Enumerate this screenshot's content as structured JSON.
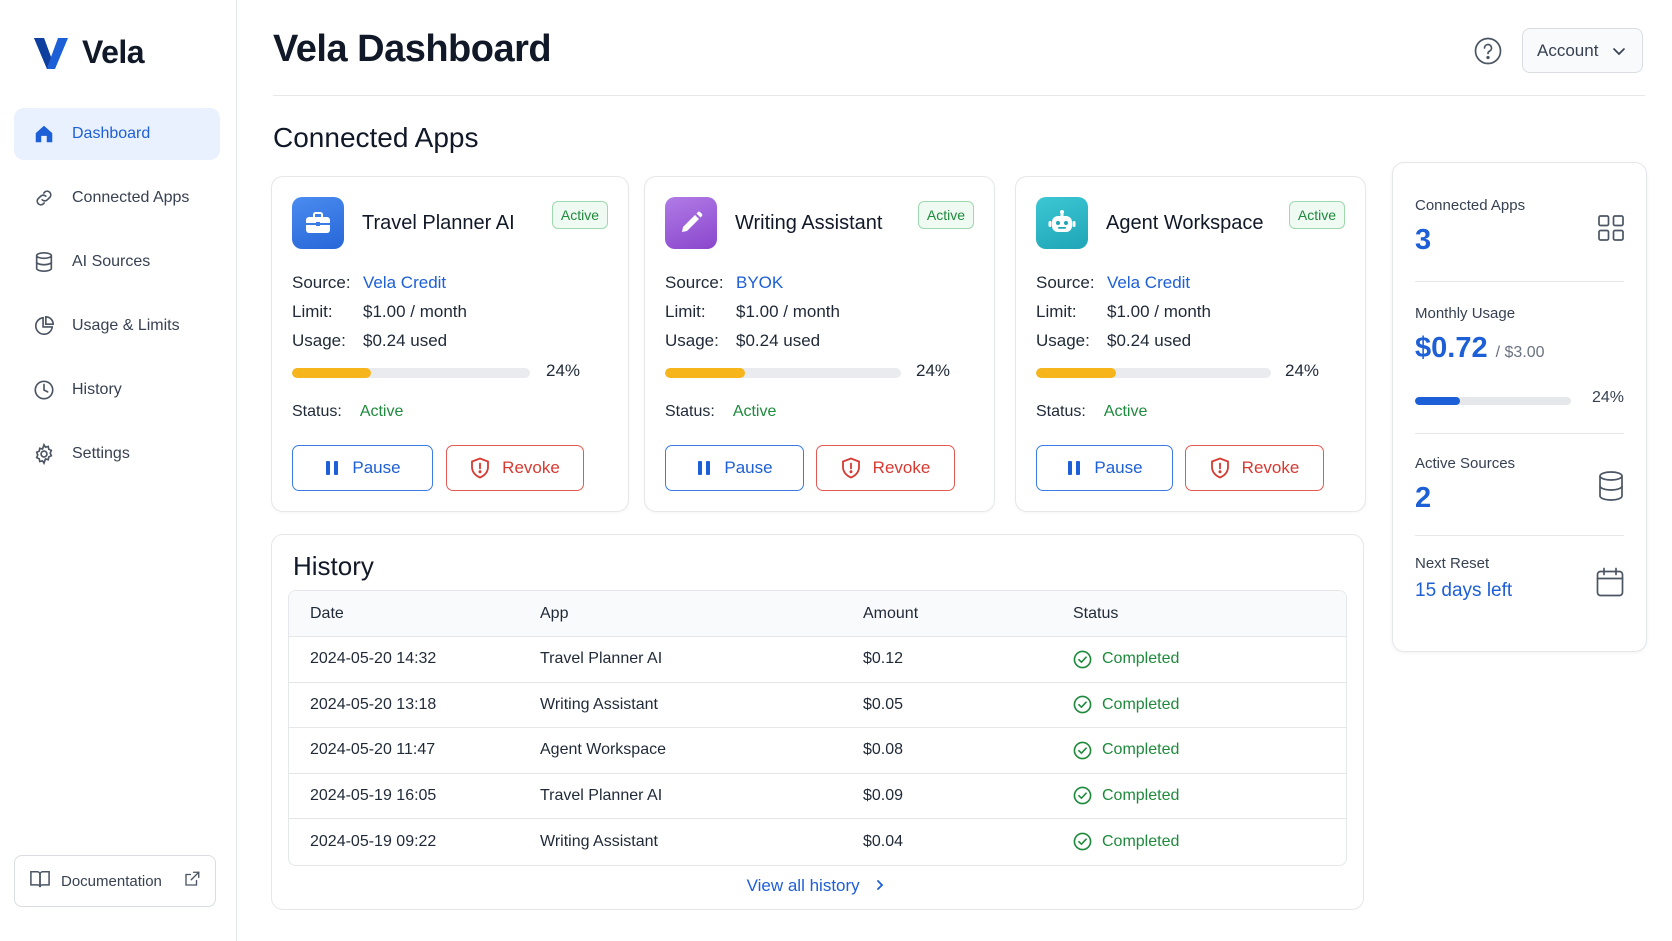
{
  "brand": {
    "name": "Vela"
  },
  "sidebar": {
    "items": [
      {
        "label": "Dashboard",
        "icon": "home-icon",
        "active": true
      },
      {
        "label": "Connected Apps",
        "icon": "link-icon"
      },
      {
        "label": "AI Sources",
        "icon": "database-icon"
      },
      {
        "label": "Usage & Limits",
        "icon": "pie-chart-icon"
      },
      {
        "label": "History",
        "icon": "clock-icon"
      },
      {
        "label": "Settings",
        "icon": "gear-icon"
      }
    ],
    "documentation": "Documentation"
  },
  "header": {
    "title": "Vela Dashboard",
    "account": "Account"
  },
  "connected": {
    "title": "Connected Apps",
    "labels": {
      "source": "Source:",
      "limit": "Limit:",
      "usage": "Usage:",
      "status": "Status:",
      "pause": "Pause",
      "revoke": "Revoke"
    },
    "apps": [
      {
        "name": "Travel Planner AI",
        "badge": "Active",
        "source": "Vela Credit",
        "limit": "$1.00 / month",
        "usage": "$0.24 used",
        "percent": "24%",
        "fraction": 0.33,
        "status": "Active",
        "icon": "briefcase-icon",
        "color": "#3b7be5"
      },
      {
        "name": "Writing Assistant",
        "badge": "Active",
        "source": "BYOK",
        "limit": "$1.00 / month",
        "usage": "$0.24 used",
        "percent": "24%",
        "fraction": 0.34,
        "status": "Active",
        "icon": "pencil-icon",
        "color": "#9b59d6"
      },
      {
        "name": "Agent Workspace",
        "badge": "Active",
        "source": "Vela Credit",
        "limit": "$1.00 / month",
        "usage": "$0.24 used",
        "percent": "24%",
        "fraction": 0.34,
        "status": "Active",
        "icon": "robot-icon",
        "color": "#27b3c4"
      }
    ]
  },
  "summary": {
    "connected_apps": {
      "label": "Connected Apps",
      "value": "3"
    },
    "monthly_usage": {
      "label": "Monthly Usage",
      "value": "$0.72",
      "of": "/ $3.00",
      "percent": "24%",
      "fraction": 0.29
    },
    "active_sources": {
      "label": "Active Sources",
      "value": "2"
    },
    "next_reset": {
      "label": "Next Reset",
      "value": "15 days left"
    }
  },
  "history": {
    "title": "History",
    "columns": [
      "Date",
      "App",
      "Amount",
      "Status"
    ],
    "rows": [
      [
        "2024-05-20 14:32",
        "Travel Planner AI",
        "$0.12",
        "Completed"
      ],
      [
        "2024-05-20 13:18",
        "Writing Assistant",
        "$0.05",
        "Completed"
      ],
      [
        "2024-05-20 11:47",
        "Agent Workspace",
        "$0.08",
        "Completed"
      ],
      [
        "2024-05-19 16:05",
        "Travel Planner AI",
        "$0.09",
        "Completed"
      ],
      [
        "2024-05-19 09:22",
        "Writing Assistant",
        "$0.04",
        "Completed"
      ]
    ],
    "view_all": "View all history"
  },
  "colors": {
    "accent": "#1d5fd6",
    "success": "#1e8a3c",
    "danger": "#d63a31",
    "progress": "#f5b51b"
  }
}
